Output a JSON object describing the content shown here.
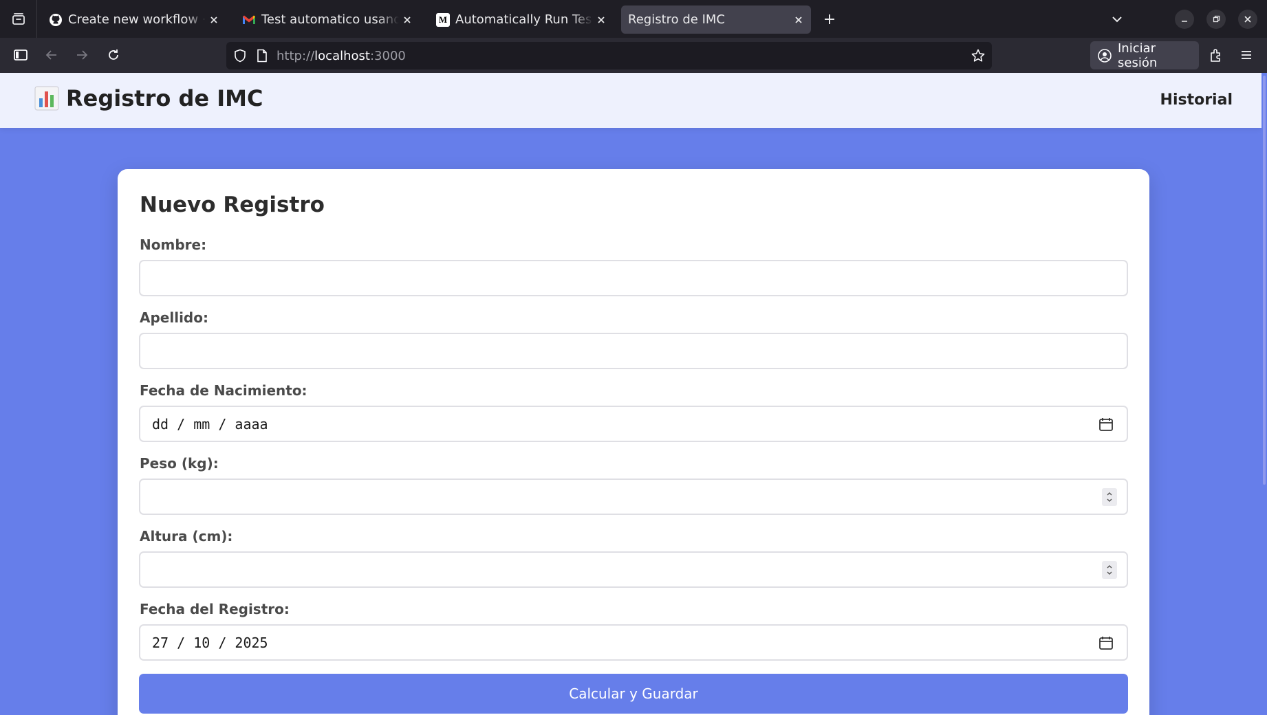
{
  "browser": {
    "tabs": [
      {
        "title": "Create new workflow · ca",
        "favicon": "github-icon"
      },
      {
        "title": "Test automatico usando g",
        "favicon": "gmail-icon"
      },
      {
        "title": "Automatically Run Tests U",
        "favicon": "medium-icon"
      },
      {
        "title": "Registro de IMC",
        "favicon": "none",
        "active": true
      }
    ],
    "url_prefix": "http://",
    "url_host": "localhost",
    "url_suffix": ":3000",
    "signin_label": "Iniciar sesión",
    "medium_favicon_text": "M"
  },
  "app": {
    "brand_title": "Registro de IMC",
    "nav_link": "Historial",
    "accent_color": "#667eea"
  },
  "form": {
    "title": "Nuevo Registro",
    "nombre_label": "Nombre:",
    "nombre_value": "",
    "apellido_label": "Apellido:",
    "apellido_value": "",
    "fecha_nacimiento_label": "Fecha de Nacimiento:",
    "fecha_nacimiento_value": "dd / mm / aaaa",
    "peso_label": "Peso (kg):",
    "peso_value": "",
    "altura_label": "Altura (cm):",
    "altura_value": "",
    "fecha_registro_label": "Fecha del Registro:",
    "fecha_registro_value": "27 / 10 / 2025",
    "submit_label": "Calcular y Guardar"
  }
}
